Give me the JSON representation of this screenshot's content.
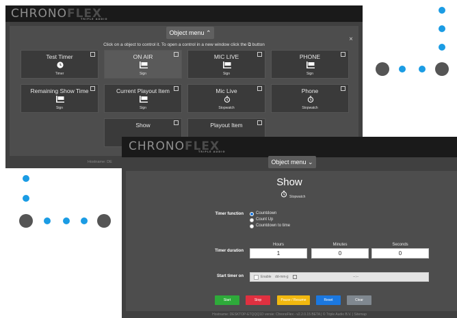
{
  "colors": {
    "accent": "#1b9ce4",
    "start": "#2eaa3a",
    "stop": "#e03040",
    "pause": "#f2b80f",
    "reset": "#1b78e0",
    "clear": "#808890"
  },
  "logo": {
    "part1": "CHRONO",
    "part2": "FLEX",
    "sub": "TRIPLE AUDIO"
  },
  "back_window": {
    "menu_label": "Object menu ⌃",
    "close_label": "×",
    "hint": "Click on a object to control it. To open a control in a new window click the ⧉ button",
    "tiles": [
      {
        "name": "Test Timer",
        "kind": "Timer",
        "icon": "clock-icon"
      },
      {
        "name": "ON AIR",
        "kind": "Sign",
        "icon": "sign-icon"
      },
      {
        "name": "MIC LIVE",
        "kind": "Sign",
        "icon": "sign-icon"
      },
      {
        "name": "PHONE",
        "kind": "Sign",
        "icon": "sign-icon"
      },
      {
        "name": "Remaining Show Time",
        "kind": "Sign",
        "icon": "sign-icon"
      },
      {
        "name": "Current Playout Item",
        "kind": "Sign",
        "icon": "sign-icon"
      },
      {
        "name": "Mic Live",
        "kind": "Stopwatch",
        "icon": "stopwatch-icon"
      },
      {
        "name": "Phone",
        "kind": "Stopwatch",
        "icon": "stopwatch-icon"
      },
      {
        "name": "Show",
        "kind": "",
        "icon": ""
      },
      {
        "name": "Playout Item",
        "kind": "",
        "icon": ""
      }
    ],
    "hostname": "Hostname: DE"
  },
  "front_window": {
    "menu_label": "Object menu ⌄",
    "title": "Show",
    "kind": "Stopwatch",
    "timer_function_label": "Timer function",
    "timer_function_options": [
      {
        "label": "Countdown",
        "selected": true
      },
      {
        "label": "Count Up",
        "selected": false
      },
      {
        "label": "Countdown to time",
        "selected": false
      }
    ],
    "timer_duration_label": "Timer duration",
    "duration": {
      "hours_label": "Hours",
      "hours_value": "1",
      "minutes_label": "Minutes",
      "minutes_value": "0",
      "seconds_label": "Seconds",
      "seconds_value": "0"
    },
    "start_timer_on_label": "Start timer on",
    "enable_label": "Enable",
    "date_placeholder": "dd-mm-jj",
    "time_placeholder": "--:--",
    "buttons": {
      "start": "Start",
      "stop": "Stop",
      "pause": "Pause / Resume",
      "reset": "Reset",
      "clear": "Clear"
    },
    "hostname": "Hostname: DESKTOP-ETQQQ1D versie: ChronoFlex - v2.2.0.15 BETA | © Triple Audio B.V. | Sitemap"
  }
}
